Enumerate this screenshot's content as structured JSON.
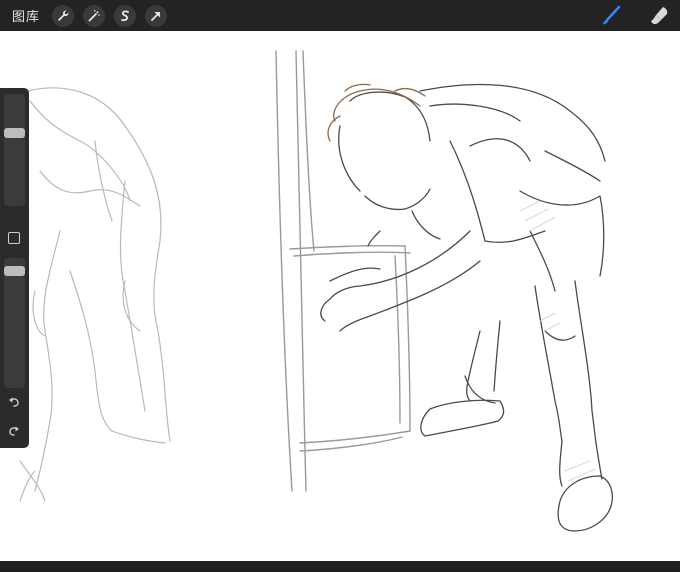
{
  "topbar": {
    "gallery_label": "图库",
    "tools": [
      {
        "name": "wrench-icon"
      },
      {
        "name": "magic-wand-icon"
      },
      {
        "name": "selection-icon"
      },
      {
        "name": "transform-arrow-icon"
      }
    ],
    "right_tools": [
      {
        "name": "brush-icon",
        "color": "#2b8cff"
      },
      {
        "name": "smudge-icon",
        "color": "#d8d8d8"
      }
    ]
  },
  "sidebar": {
    "brush_size_level": 0.15,
    "opacity_level": 0.05
  },
  "colors": {
    "chrome": "#232325",
    "accent": "#2b8cff",
    "canvas": "#ffffff"
  }
}
